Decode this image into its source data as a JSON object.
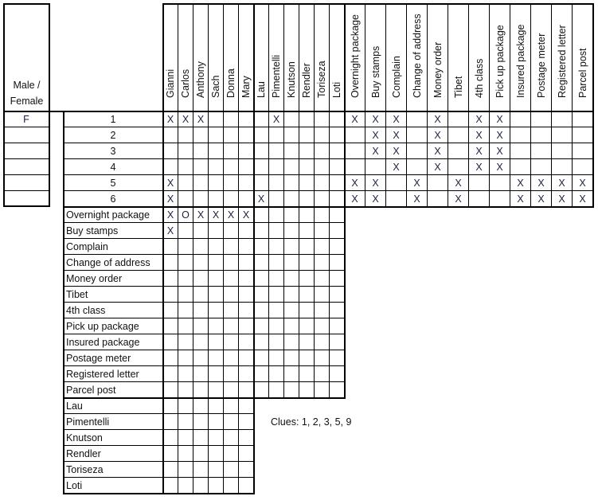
{
  "gender_column": {
    "header": "Male / Female",
    "values": [
      "F",
      "",
      "",
      "",
      "",
      ""
    ]
  },
  "column_groups": {
    "first_names": [
      "Gianni",
      "Carlos",
      "Anthony",
      "Sach",
      "Donna",
      "Mary"
    ],
    "last_names": [
      "Lau",
      "Pimentelli",
      "Knutson",
      "Rendler",
      "Toriseza",
      "Loti"
    ],
    "errands": [
      "Overnight package",
      "Buy stamps",
      "Complain",
      "Change of address",
      "Money order",
      "Tibet",
      "4th class",
      "Pick up package",
      "Insured package",
      "Postage meter",
      "Registered letter",
      "Parcel post"
    ]
  },
  "number_rows": [
    {
      "label": "1",
      "marks": [
        "X",
        "X",
        "X",
        "",
        "",
        "",
        "",
        "X",
        "",
        "",
        "",
        "",
        "X",
        "X",
        "X",
        "",
        "X",
        "",
        "X",
        "X",
        "",
        "",
        "",
        ""
      ]
    },
    {
      "label": "2",
      "marks": [
        "",
        "",
        "",
        "",
        "",
        "",
        "",
        "",
        "",
        "",
        "",
        "",
        "",
        "X",
        "X",
        "",
        "X",
        "",
        "X",
        "X",
        "",
        "",
        "",
        ""
      ]
    },
    {
      "label": "3",
      "marks": [
        "",
        "",
        "",
        "",
        "",
        "",
        "",
        "",
        "",
        "",
        "",
        "",
        "",
        "X",
        "X",
        "",
        "X",
        "",
        "X",
        "X",
        "",
        "",
        "",
        ""
      ]
    },
    {
      "label": "4",
      "marks": [
        "",
        "",
        "",
        "",
        "",
        "",
        "",
        "",
        "",
        "",
        "",
        "",
        "",
        "",
        "X",
        "",
        "X",
        "",
        "X",
        "X",
        "",
        "",
        "",
        ""
      ]
    },
    {
      "label": "5",
      "marks": [
        "X",
        "",
        "",
        "",
        "",
        "",
        "",
        "",
        "",
        "",
        "",
        "",
        "X",
        "X",
        "",
        "X",
        "",
        "X",
        "",
        "",
        "X",
        "X",
        "X",
        "X"
      ]
    },
    {
      "label": "6",
      "marks": [
        "X",
        "",
        "",
        "",
        "",
        "",
        "X",
        "",
        "",
        "",
        "",
        "",
        "X",
        "X",
        "",
        "X",
        "",
        "X",
        "",
        "",
        "X",
        "X",
        "X",
        "X"
      ]
    }
  ],
  "errand_rows": [
    {
      "label": "Overnight package",
      "marks": [
        "X",
        "O",
        "X",
        "X",
        "X",
        "X",
        "",
        "",
        "",
        "",
        "",
        ""
      ]
    },
    {
      "label": "Buy stamps",
      "marks": [
        "X",
        "",
        "",
        "",
        "",
        "",
        "",
        "",
        "",
        "",
        "",
        ""
      ]
    },
    {
      "label": "Complain",
      "marks": []
    },
    {
      "label": "Change of address",
      "marks": []
    },
    {
      "label": "Money order",
      "marks": []
    },
    {
      "label": "Tibet",
      "marks": []
    },
    {
      "label": "4th class",
      "marks": []
    },
    {
      "label": "Pick up package",
      "marks": []
    },
    {
      "label": "Insured package",
      "marks": []
    },
    {
      "label": "Postage meter",
      "marks": []
    },
    {
      "label": "Registered letter",
      "marks": []
    },
    {
      "label": "Parcel post",
      "marks": []
    }
  ],
  "lastname_rows": [
    {
      "label": "Lau",
      "marks": []
    },
    {
      "label": "Pimentelli",
      "marks": []
    },
    {
      "label": "Knutson",
      "marks": []
    },
    {
      "label": "Rendler",
      "marks": []
    },
    {
      "label": "Toriseza",
      "marks": []
    },
    {
      "label": "Loti",
      "marks": []
    }
  ],
  "clues": "Clues: 1, 2, 3, 5, 9"
}
